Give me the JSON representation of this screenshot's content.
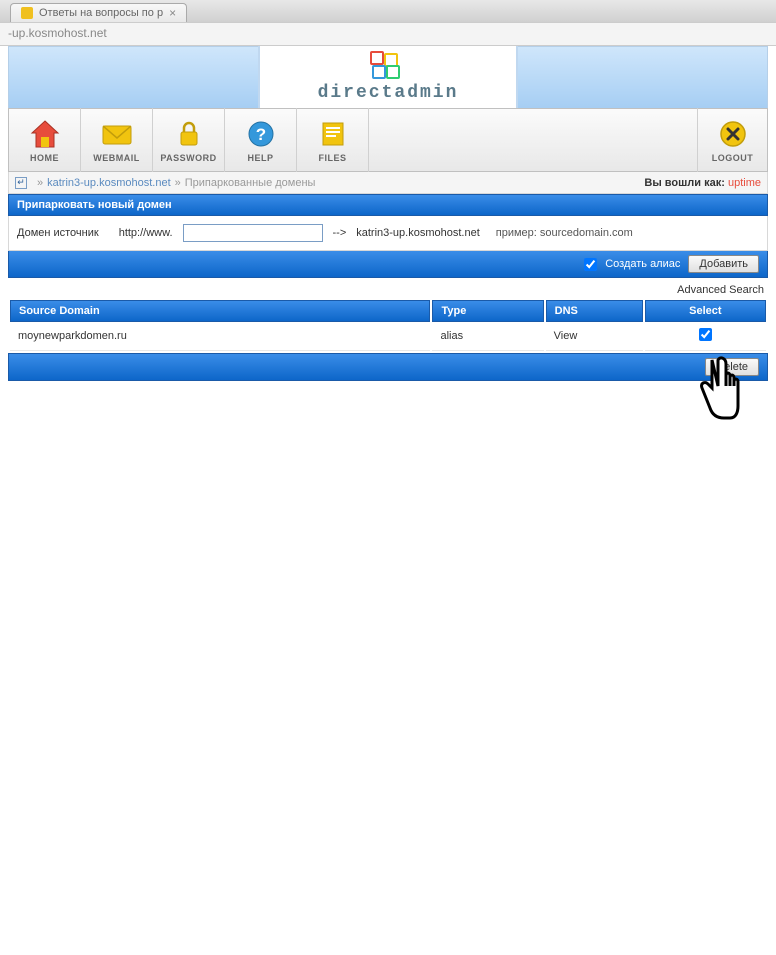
{
  "browser": {
    "tab_title": "Ответы на вопросы по р",
    "address": "-up.kosmohost.net"
  },
  "brand": "directadmin",
  "nav": {
    "home": "HOME",
    "webmail": "WEBMAIL",
    "password": "PASSWORD",
    "help": "HELP",
    "files": "FILES",
    "logout": "LOGOUT"
  },
  "breadcrumb": {
    "domain_link": "katrin3-up.kosmohost.net",
    "page": "Припаркованные домены",
    "logged_in_as": "Вы вошли как:",
    "user": "uptime"
  },
  "section": {
    "title": "Припарковать новый домен"
  },
  "form": {
    "label": "Домен источник",
    "prefix": "http://www.",
    "arrow": "-->",
    "target": "katrin3-up.kosmohost.net",
    "example": "пример: sourcedomain.com",
    "create_alias": "Создать алиас",
    "add_button": "Добавить"
  },
  "advanced_search": "Advanced Search",
  "table": {
    "headers": {
      "source": "Source Domain",
      "type": "Type",
      "dns": "DNS",
      "select": "Select"
    },
    "rows": [
      {
        "source": "moynewparkdomen.ru",
        "type": "alias",
        "dns": "View"
      }
    ]
  },
  "delete_button": "Delete"
}
